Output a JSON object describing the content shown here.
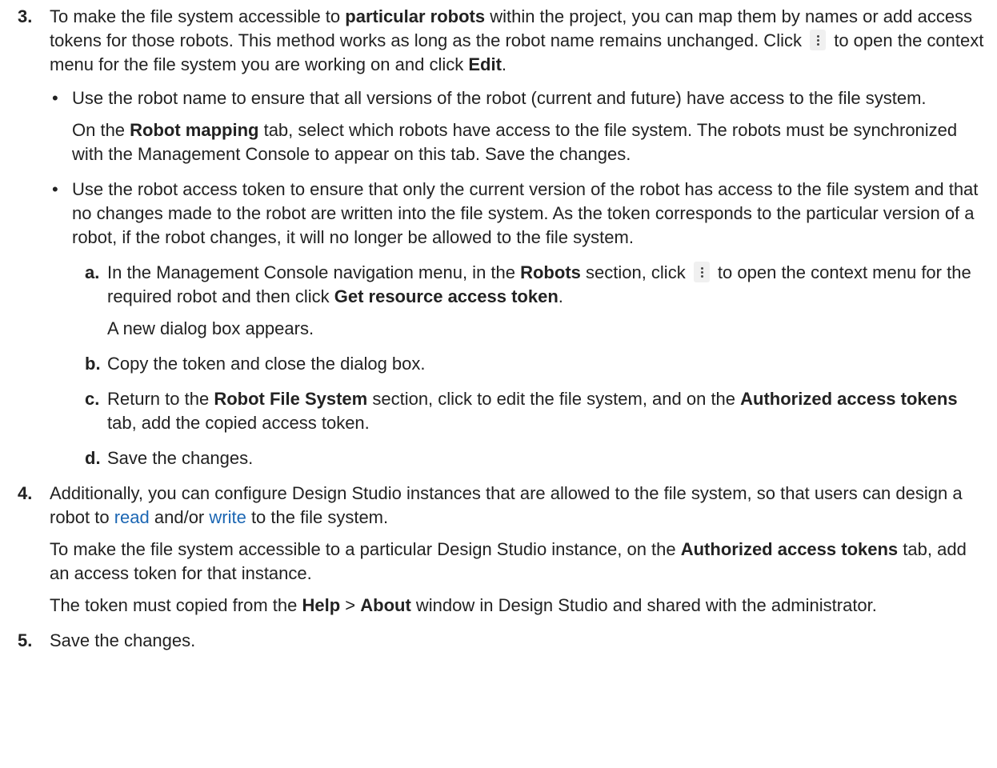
{
  "steps": {
    "s3": {
      "num": "3.",
      "p1": [
        "To make the file system accessible to ",
        "particular robots",
        " within the project, you can map them by names or add access tokens for those robots. This method works as long as the robot name remains unchanged. Click ",
        " to open the context menu for the file system you are working on and click ",
        "Edit",
        "."
      ],
      "b1": {
        "text": "Use the robot name to ensure that all versions of the robot (current and future) have access to the file system.",
        "detail": [
          "On the ",
          "Robot mapping",
          " tab, select which robots have access to the file system. The robots must be synchronized with the Management Console to appear on this tab. Save the changes."
        ]
      },
      "b2": {
        "text": "Use the robot access token to ensure that only the current version of the robot has access to the file system and that no changes made to the robot are written into the file system. As the token corresponds to the particular version of a robot, if the robot changes, it will no longer be allowed to the file system.",
        "sub_a": {
          "letter": "a.",
          "parts": [
            "In the Management Console navigation menu, in the ",
            "Robots",
            " section, click ",
            " to open the context menu for the required robot and then click ",
            "Get resource access token",
            "."
          ],
          "after": "A new dialog box appears."
        },
        "sub_b": {
          "letter": "b.",
          "text": "Copy the token and close the dialog box."
        },
        "sub_c": {
          "letter": "c.",
          "parts": [
            "Return to the ",
            "Robot File System",
            " section, click to edit the file system, and on the ",
            "Authorized access tokens",
            " tab, add the copied access token."
          ]
        },
        "sub_d": {
          "letter": "d.",
          "text": "Save the changes."
        }
      }
    },
    "s4": {
      "num": "4.",
      "p1": [
        "Additionally, you can configure Design Studio instances that are allowed to the file system, so that users can design a robot to ",
        "read",
        " and/or ",
        "write",
        " to the file system."
      ],
      "p2": [
        "To make the file system accessible to a particular Design Studio instance, on the ",
        "Authorized access tokens",
        " tab, add an access token for that instance."
      ],
      "p3": [
        "The token must copied from the ",
        "Help",
        " > ",
        "About",
        " window in Design Studio and shared with the administrator."
      ]
    },
    "s5": {
      "num": "5.",
      "text": "Save the changes."
    }
  },
  "bullet_char": "•",
  "icons": {
    "menu": "kebab-menu-icon"
  },
  "colors": {
    "link": "#1b66b3",
    "text": "#222222"
  }
}
